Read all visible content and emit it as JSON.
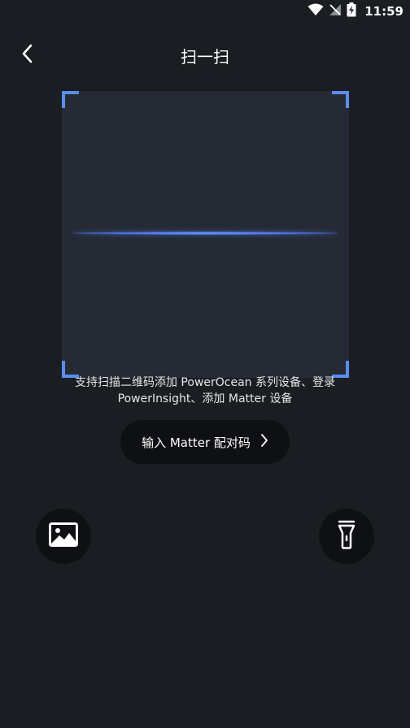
{
  "status_bar": {
    "time": "11:59",
    "icons": [
      "wifi-icon",
      "no-signal-icon",
      "battery-charging-icon"
    ]
  },
  "header": {
    "title": "扫一扫",
    "back_icon": "chevron-left-icon"
  },
  "scanner": {
    "hint": "支持扫描二维码添加 PowerOcean 系列设备、登录 PowerInsight、添加 Matter 设备",
    "accent_color": "#5b8def"
  },
  "matter_button": {
    "label": "输入 Matter 配对码",
    "icon": "chevron-right-icon"
  },
  "actions": {
    "gallery_icon": "image-icon",
    "flashlight_icon": "flashlight-icon"
  },
  "colors": {
    "background": "#1a1d21",
    "frame": "#252a35",
    "button_bg": "#0e1013"
  }
}
